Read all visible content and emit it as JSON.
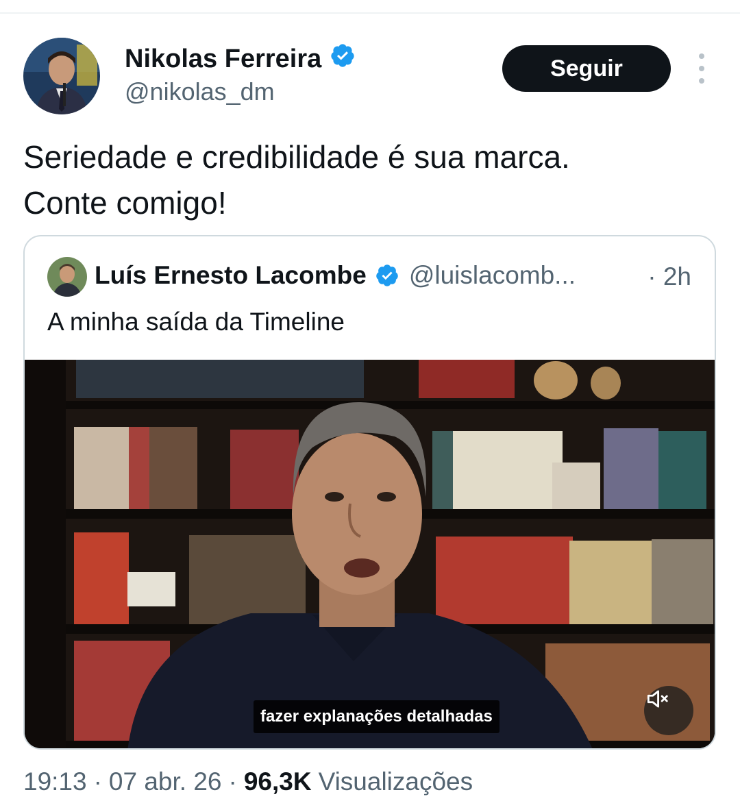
{
  "tweet": {
    "author_name": "Nikolas Ferreira",
    "author_handle": "@nikolas_dm",
    "follow_label": "Seguir",
    "text_lines": [
      "Seriedade e credibilidade é sua marca.",
      "Conte comigo!"
    ],
    "time": "19:13",
    "date": "07 abr. 26",
    "separator": "·",
    "views_count": "96,3K",
    "views_label": "Visualizações"
  },
  "quote": {
    "author_name": "Luís Ernesto Lacombe",
    "author_handle": "@luislacomb...",
    "time": "· 2h",
    "text": "A minha saída da Timeline",
    "video_caption": "fazer explanações detalhadas"
  },
  "colors": {
    "verified_blue": "#1d9bf0",
    "follow_button_bg": "#0f1419",
    "secondary_text": "#536471",
    "card_border": "#cfd9de"
  },
  "icons": {
    "verified": "verified-badge-icon",
    "more": "more-vertical-icon",
    "mute": "volume-muted-icon"
  }
}
